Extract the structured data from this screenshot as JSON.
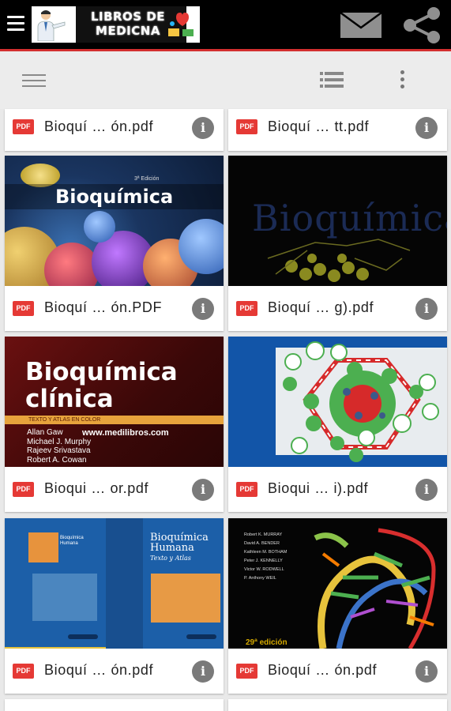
{
  "app": {
    "logo_line1": "LIBROS DE",
    "logo_line2": "MEDICNA"
  },
  "icons": {
    "menu": "hamburger-icon",
    "mail": "mail-icon",
    "share": "share-icon",
    "drawer": "drawer-menu-icon",
    "list_view": "list-view-icon",
    "more": "more-vert-icon",
    "pdf": "pdf-icon",
    "info": "info-icon"
  },
  "colors": {
    "app_bar": "#000000",
    "accent_line": "#d32f2f",
    "pdf_badge": "#e53935",
    "info": "#7a7a7a"
  },
  "files": [
    {
      "name": "Bioquí … ón.pdf",
      "pdf": "PDF",
      "info": "i"
    },
    {
      "name": "Bioquí … tt.pdf",
      "pdf": "PDF",
      "info": "i"
    },
    {
      "name": "Bioquí … ón.PDF",
      "pdf": "PDF",
      "info": "i"
    },
    {
      "name": "Bioquí … g).pdf",
      "pdf": "PDF",
      "info": "i"
    },
    {
      "name": "Bioqui … or.pdf",
      "pdf": "PDF",
      "info": "i"
    },
    {
      "name": "Bioqui … i).pdf",
      "pdf": "PDF",
      "info": "i"
    },
    {
      "name": "Bioquí … ón.pdf",
      "pdf": "PDF",
      "info": "i"
    },
    {
      "name": "Bioquí … ón.pdf",
      "pdf": "PDF",
      "info": "i"
    }
  ],
  "covers": {
    "c1_title": "Bioquímica",
    "c1_edition": "3ª Edición",
    "c2_title": "Bioquímica",
    "c3_title1": "Bioquímica",
    "c3_title2": "clínica",
    "c3_sub": "TEXTO Y ATLAS EN COLOR",
    "c3_authors": [
      "Allan Gaw",
      "Michael J. Murphy",
      "Rajeev Srivastava",
      "Robert A. Cowan"
    ],
    "c3_site": "www.medilibros.com",
    "c5_title1": "Bioquímica",
    "c5_title2": "Humana",
    "c5_sub": "Texto y Atlas",
    "c6_authors": [
      "Robert K. MURRAY",
      "David A. BENDER",
      "Kathleen M. BOTHAM",
      "Peter J. KENNELLY",
      "Victor W. RODWELL",
      "P. Anthony WEIL"
    ],
    "c6_edition": "29ª edición"
  }
}
